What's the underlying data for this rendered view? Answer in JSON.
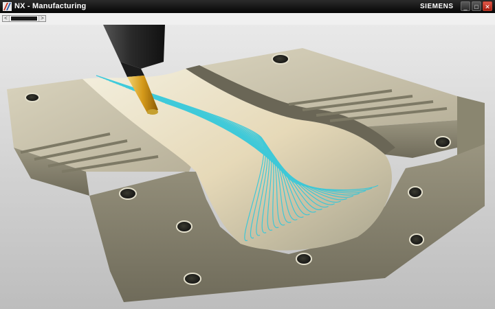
{
  "titlebar": {
    "title": "NX - Manufacturing",
    "brand": "SIEMENS",
    "icon": "nx-app-icon"
  },
  "window_controls": {
    "minimize": "_",
    "maximize": "□",
    "close": "✕"
  },
  "scrollbar": {
    "left_arrow": "<",
    "right_arrow": ">"
  },
  "viewport": {
    "scene": "cnc-mold-machining-toolpath"
  },
  "colors": {
    "toolpath": "#2ec8dc",
    "mold_face": "#c9c2aa",
    "mold_side": "#8d8872",
    "tool_holder": "#3a3a3a",
    "tool_tip": "#d8a020"
  }
}
